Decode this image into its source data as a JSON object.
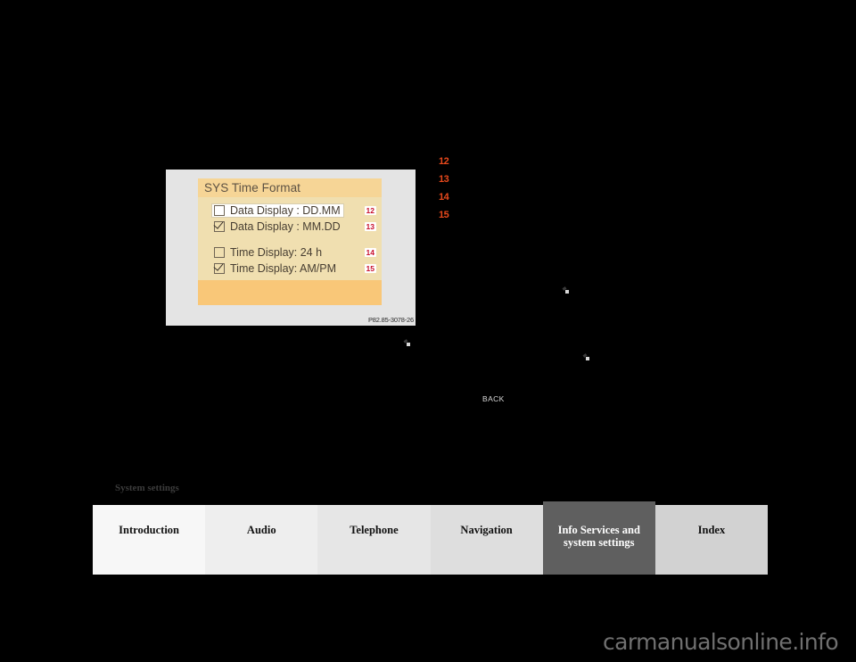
{
  "figure": {
    "reference": "P82.85-3078-26",
    "screen": {
      "title": "SYS Time Format",
      "options": [
        {
          "label": "Data Display : DD.MM",
          "checked": false,
          "callout": "12",
          "highlighted": true
        },
        {
          "label": "Data Display : MM.DD",
          "checked": true,
          "callout": "13",
          "highlighted": false
        },
        {
          "label": "Time Display: 24 h",
          "checked": false,
          "callout": "14",
          "highlighted": false
        },
        {
          "label": "Time Display: AM/PM",
          "checked": true,
          "callout": "15",
          "highlighted": false
        }
      ]
    }
  },
  "markers": [
    "12",
    "13",
    "14",
    "15"
  ],
  "controls": {
    "back_label": "BACK"
  },
  "section": {
    "heading": "System settings"
  },
  "tabbar": {
    "tabs": [
      {
        "label": "Introduction",
        "active": false
      },
      {
        "label": "Audio",
        "active": false
      },
      {
        "label": "Telephone",
        "active": false
      },
      {
        "label": "Navigation",
        "active": false
      },
      {
        "label": "Info Services and system settings",
        "active": true
      },
      {
        "label": "Index",
        "active": false
      }
    ]
  },
  "watermark": {
    "text": "carmanualsonline.info"
  },
  "colors": {
    "marker_orange": "#e8491c",
    "callout_red": "#c8102e",
    "screen_background": "#f0dfb0",
    "screen_title_band": "#f6d596",
    "screen_footer_band": "#f9c778",
    "active_tab": "#5f5f5f"
  }
}
